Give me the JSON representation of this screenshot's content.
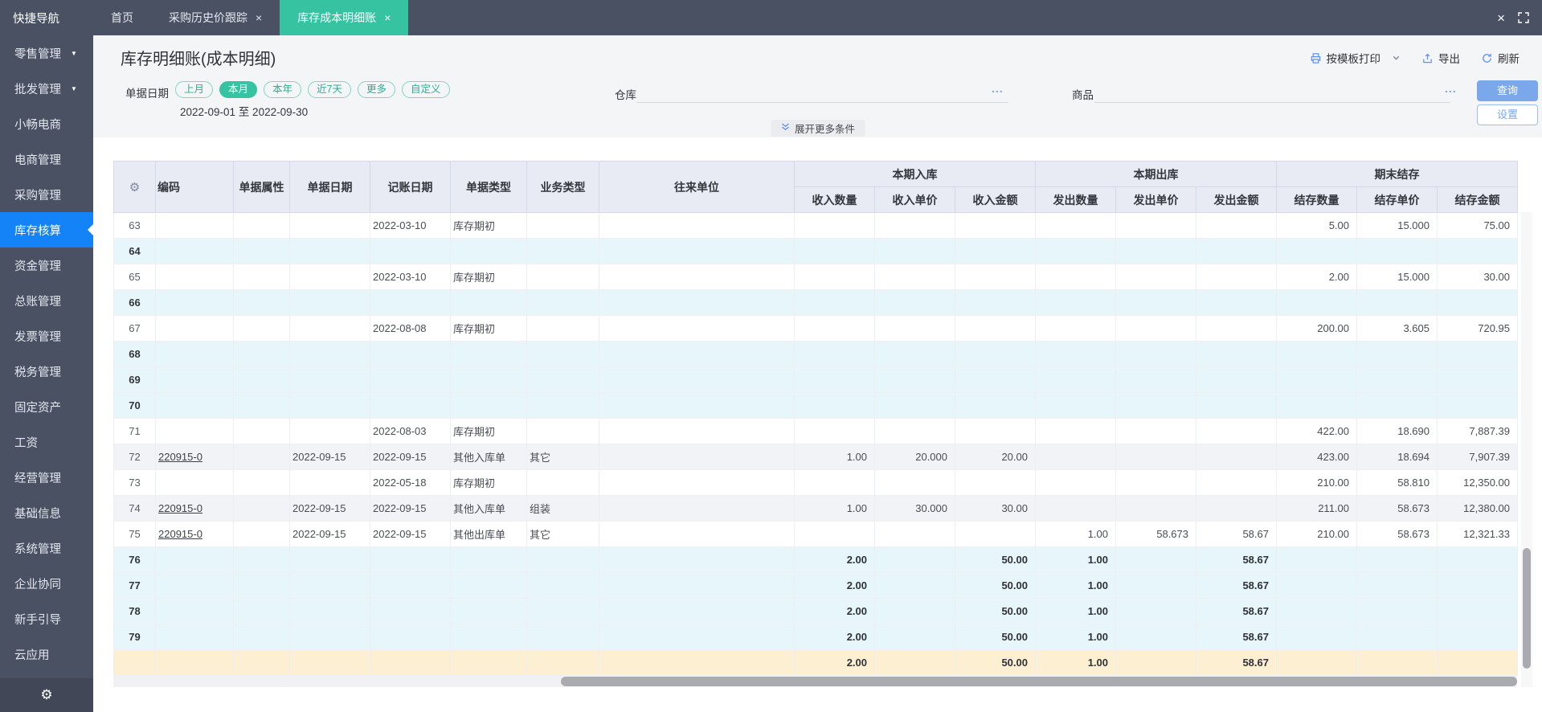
{
  "colors": {
    "topbar_bg": "#4a5163",
    "active_tab": "#36c3a1",
    "active_sidebar": "#1583f8",
    "accent_blue": "#5f92ee",
    "button_blue": "#7ba7eb",
    "header_bg": "#e9ebf4",
    "row_cyan": "#e6f6fa",
    "row_grey": "#f2f3f6",
    "row_yellow": "#fcefd2",
    "pill_teal": "#2fae92"
  },
  "topbar": {
    "quick_nav": "快捷导航",
    "tabs": [
      {
        "label": "首页",
        "closable": false,
        "active": false
      },
      {
        "label": "采购历史价跟踪",
        "closable": true,
        "active": false
      },
      {
        "label": "库存成本明细账",
        "closable": true,
        "active": true
      }
    ]
  },
  "sidebar": {
    "items": [
      {
        "label": "零售管理",
        "caret": true
      },
      {
        "label": "批发管理",
        "caret": true
      },
      {
        "label": "小畅电商"
      },
      {
        "label": "电商管理"
      },
      {
        "label": "采购管理"
      },
      {
        "label": "库存核算",
        "active": true
      },
      {
        "label": "资金管理"
      },
      {
        "label": "总账管理"
      },
      {
        "label": "发票管理"
      },
      {
        "label": "税务管理"
      },
      {
        "label": "固定资产"
      },
      {
        "label": "工资"
      },
      {
        "label": "经营管理"
      },
      {
        "label": "基础信息"
      },
      {
        "label": "系统管理"
      },
      {
        "label": "企业协同"
      },
      {
        "label": "新手引导"
      },
      {
        "label": "云应用"
      }
    ],
    "footer_icon": "gear-icon"
  },
  "header": {
    "title": "库存明细账(成本明细)",
    "toolbar": {
      "print": "按模板打印",
      "export": "导出",
      "refresh": "刷新"
    }
  },
  "filters": {
    "date_label": "单据日期",
    "date_pills": [
      {
        "label": "上月"
      },
      {
        "label": "本月",
        "active": true
      },
      {
        "label": "本年"
      },
      {
        "label": "近7天"
      },
      {
        "label": "更多"
      },
      {
        "label": "自定义"
      }
    ],
    "date_range": "2022-09-01 至 2022-09-30",
    "warehouse_label": "仓库",
    "product_label": "商品",
    "warehouse_value": "",
    "product_value": "",
    "ellipsis": "...",
    "query_button": "查询",
    "settings_button": "设置",
    "expand_more": "展开更多条件"
  },
  "table": {
    "left_columns": [
      "编码",
      "单据属性",
      "单据日期",
      "记账日期",
      "单据类型",
      "业务类型",
      "往来单位"
    ],
    "groups": [
      {
        "label": "本期入库",
        "children": [
          "收入数量",
          "收入单价",
          "收入金额"
        ]
      },
      {
        "label": "本期出库",
        "children": [
          "发出数量",
          "发出单价",
          "发出金额"
        ]
      },
      {
        "label": "期末结存",
        "children": [
          "结存数量",
          "结存单价",
          "结存金额"
        ]
      }
    ],
    "rows": [
      {
        "num": "63",
        "book_date": "2022-03-10",
        "doc_type": "库存期初",
        "bal_qty": "5.00",
        "bal_price": "15.000",
        "bal_amt": "75.00",
        "style": "white"
      },
      {
        "num": "64",
        "style": "cyan"
      },
      {
        "num": "65",
        "book_date": "2022-03-10",
        "doc_type": "库存期初",
        "bal_qty": "2.00",
        "bal_price": "15.000",
        "bal_amt": "30.00",
        "style": "white"
      },
      {
        "num": "66",
        "style": "cyan"
      },
      {
        "num": "67",
        "book_date": "2022-08-08",
        "doc_type": "库存期初",
        "bal_qty": "200.00",
        "bal_price": "3.605",
        "bal_amt": "720.95",
        "style": "white"
      },
      {
        "num": "68",
        "style": "cyan"
      },
      {
        "num": "69",
        "style": "cyan"
      },
      {
        "num": "70",
        "style": "cyan"
      },
      {
        "num": "71",
        "book_date": "2022-08-03",
        "doc_type": "库存期初",
        "bal_qty": "422.00",
        "bal_price": "18.690",
        "bal_amt": "7,887.39",
        "style": "white"
      },
      {
        "num": "72",
        "code": "220915-0",
        "doc_date": "2022-09-15",
        "book_date": "2022-09-15",
        "doc_type": "其他入库单",
        "biz_type": "其它",
        "in_qty": "1.00",
        "in_price": "20.000",
        "in_amt": "20.00",
        "bal_qty": "423.00",
        "bal_price": "18.694",
        "bal_amt": "7,907.39",
        "style": "grey"
      },
      {
        "num": "73",
        "book_date": "2022-05-18",
        "doc_type": "库存期初",
        "bal_qty": "210.00",
        "bal_price": "58.810",
        "bal_amt": "12,350.00",
        "style": "white"
      },
      {
        "num": "74",
        "code": "220915-0",
        "doc_date": "2022-09-15",
        "book_date": "2022-09-15",
        "doc_type": "其他入库单",
        "biz_type": "组装",
        "in_qty": "1.00",
        "in_price": "30.000",
        "in_amt": "30.00",
        "bal_qty": "211.00",
        "bal_price": "58.673",
        "bal_amt": "12,380.00",
        "style": "grey"
      },
      {
        "num": "75",
        "code": "220915-0",
        "doc_date": "2022-09-15",
        "book_date": "2022-09-15",
        "doc_type": "其他出库单",
        "biz_type": "其它",
        "out_qty": "1.00",
        "out_price": "58.673",
        "out_amt": "58.67",
        "bal_qty": "210.00",
        "bal_price": "58.673",
        "bal_amt": "12,321.33",
        "style": "white"
      },
      {
        "num": "76",
        "in_qty": "2.00",
        "in_amt": "50.00",
        "out_qty": "1.00",
        "out_amt": "58.67",
        "style": "cyan bold"
      },
      {
        "num": "77",
        "in_qty": "2.00",
        "in_amt": "50.00",
        "out_qty": "1.00",
        "out_amt": "58.67",
        "style": "cyan bold"
      },
      {
        "num": "78",
        "in_qty": "2.00",
        "in_amt": "50.00",
        "out_qty": "1.00",
        "out_amt": "58.67",
        "style": "cyan bold"
      },
      {
        "num": "79",
        "in_qty": "2.00",
        "in_amt": "50.00",
        "out_qty": "1.00",
        "out_amt": "58.67",
        "style": "cyan bold"
      },
      {
        "num": "",
        "in_qty": "2.00",
        "in_amt": "50.00",
        "out_qty": "1.00",
        "out_amt": "58.67",
        "style": "yellow"
      }
    ]
  }
}
